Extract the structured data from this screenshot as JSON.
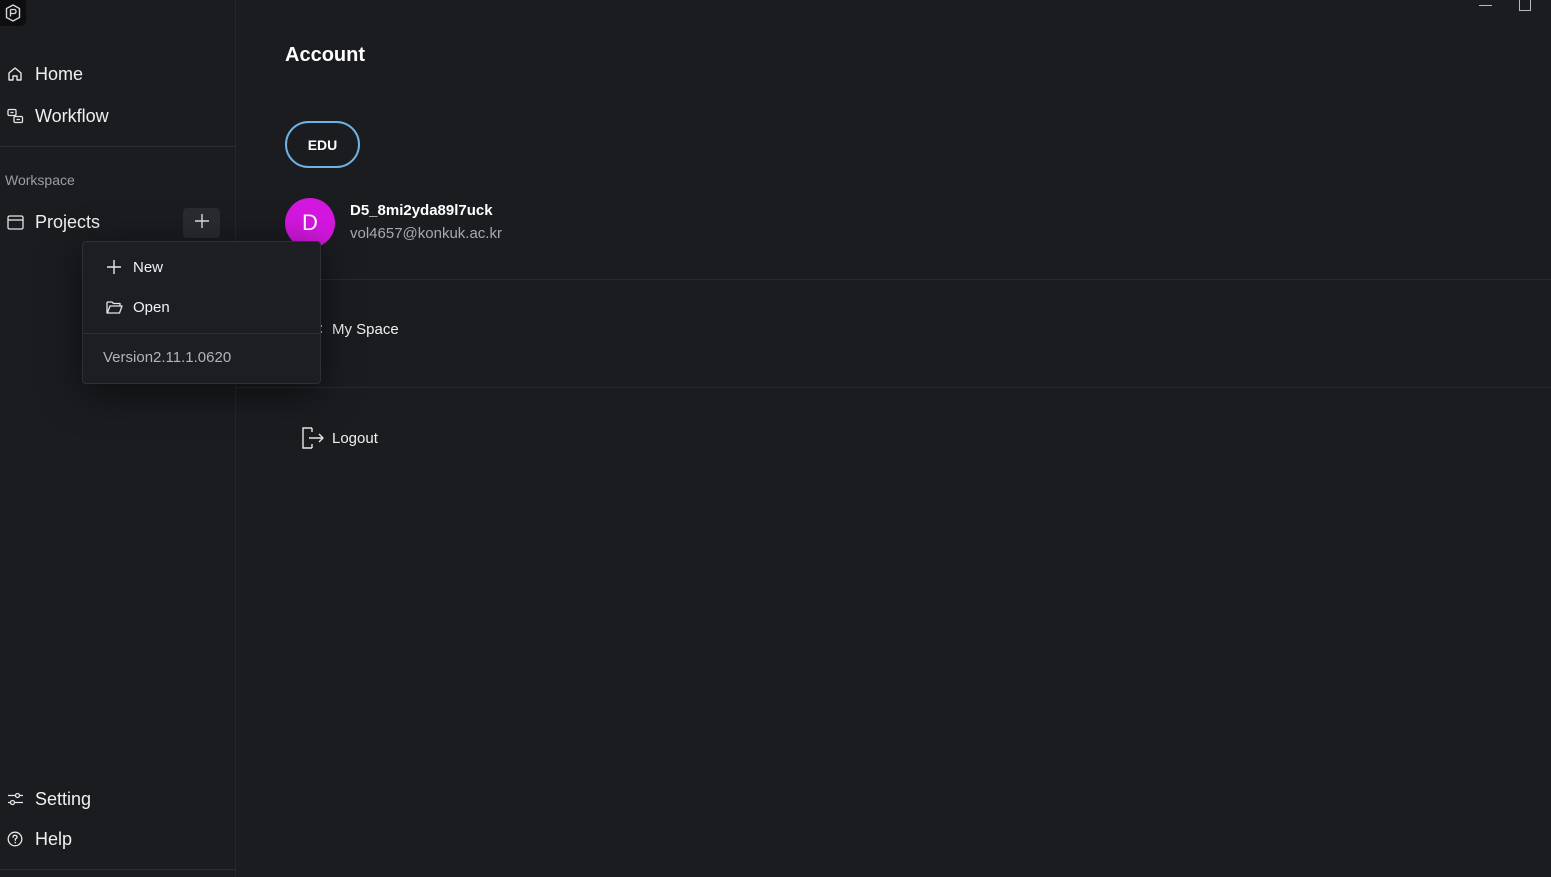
{
  "sidebar": {
    "logo": "app-logo-icon",
    "nav": [
      {
        "label": "Home",
        "icon": "home-icon"
      },
      {
        "label": "Workflow",
        "icon": "workflow-icon"
      }
    ],
    "section_label": "Workspace",
    "projects": {
      "label": "Projects",
      "icon": "panel-icon",
      "add_icon": "plus-icon"
    },
    "bottom": [
      {
        "label": "Setting",
        "icon": "sliders-icon"
      },
      {
        "label": "Help",
        "icon": "help-circle-icon"
      }
    ]
  },
  "menu": {
    "items": [
      {
        "label": "New",
        "icon": "plus-icon"
      },
      {
        "label": "Open",
        "icon": "folder-open-icon"
      }
    ],
    "version": "Version2.11.1.0620"
  },
  "main": {
    "title": "Account",
    "badge": "EDU",
    "user": {
      "initial": "D",
      "name": "D5_8mi2yda89l7uck",
      "email": "vol4657@konkuk.ac.kr",
      "avatar_color": "#d417e0"
    },
    "space_label": "My Space",
    "logout_label": "Logout"
  },
  "colors": {
    "background": "#1b1c20",
    "badge_border": "#6fb3e6",
    "avatar": "#d417e0"
  }
}
